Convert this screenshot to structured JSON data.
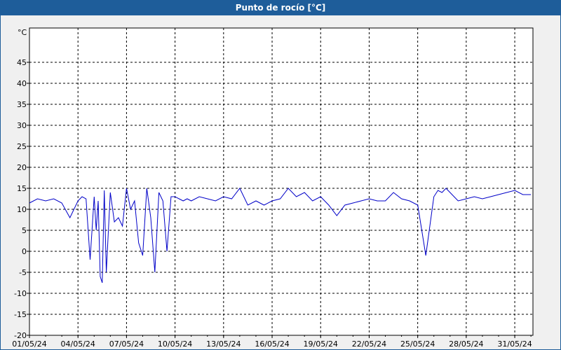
{
  "window": {
    "title": "Punto de rocío [°C]"
  },
  "colors": {
    "titlebar": "#1e5d9a",
    "series": "#0000c8",
    "plot_background": "#ffffff"
  },
  "chart_data": {
    "type": "line",
    "title": "Punto de rocío [°C]",
    "ylabel": "°C",
    "xlabel": "",
    "ylim": [
      -20,
      50
    ],
    "xlim": [
      "01/05/24",
      "01/06/24"
    ],
    "grid": true,
    "y_ticks": [
      "-20",
      "-15",
      "-10",
      "-5",
      "0",
      "5",
      "10",
      "15",
      "20",
      "25",
      "30",
      "35",
      "40",
      "45"
    ],
    "x_ticks": [
      "01/05/24",
      "04/05/24",
      "07/05/24",
      "10/05/24",
      "13/05/24",
      "16/05/24",
      "19/05/24",
      "22/05/24",
      "25/05/24",
      "28/05/24",
      "31/05/24"
    ],
    "series": [
      {
        "color": "#0000c8",
        "x": [
          "01/05 00:00",
          "01/05 12:00",
          "02/05 00:00",
          "02/05 12:00",
          "03/05 00:00",
          "03/05 12:00",
          "04/05 00:00",
          "04/05 06:00",
          "04/05 12:00",
          "04/05 18:00",
          "05/05 00:00",
          "05/05 03:00",
          "05/05 06:00",
          "05/05 09:00",
          "05/05 12:00",
          "05/05 15:00",
          "05/05 18:00",
          "06/05 00:00",
          "06/05 06:00",
          "06/05 12:00",
          "06/05 18:00",
          "07/05 00:00",
          "07/05 06:00",
          "07/05 12:00",
          "07/05 18:00",
          "08/05 00:00",
          "08/05 06:00",
          "08/05 12:00",
          "08/05 18:00",
          "09/05 00:00",
          "09/05 06:00",
          "09/05 12:00",
          "09/05 18:00",
          "10/05 00:00",
          "10/05 06:00",
          "10/05 12:00",
          "10/05 18:00",
          "11/05 00:00",
          "11/05 12:00",
          "12/05 00:00",
          "12/05 12:00",
          "13/05 00:00",
          "13/05 12:00",
          "14/05 00:00",
          "14/05 12:00",
          "15/05 00:00",
          "15/05 12:00",
          "16/05 00:00",
          "16/05 12:00",
          "17/05 00:00",
          "17/05 12:00",
          "18/05 00:00",
          "18/05 12:00",
          "19/05 00:00",
          "19/05 12:00",
          "20/05 00:00",
          "20/05 12:00",
          "21/05 00:00",
          "21/05 12:00",
          "22/05 00:00",
          "22/05 12:00",
          "23/05 00:00",
          "23/05 12:00",
          "24/05 00:00",
          "24/05 12:00",
          "25/05 00:00",
          "25/05 12:00",
          "26/05 00:00",
          "26/05 06:00",
          "26/05 12:00",
          "26/05 18:00",
          "27/05 00:00",
          "27/05 12:00",
          "28/05 00:00",
          "28/05 12:00",
          "29/05 00:00",
          "29/05 12:00",
          "30/05 00:00",
          "30/05 12:00",
          "31/05 00:00",
          "31/05 12:00",
          "01/06 00:00"
        ],
        "y": [
          11.5,
          12.5,
          12,
          12.5,
          11.5,
          8,
          12,
          13,
          12.5,
          -2,
          13,
          5,
          12,
          -6,
          -7.5,
          14.5,
          -5,
          14,
          7,
          8,
          6,
          15,
          10,
          12,
          2,
          -1,
          15,
          8,
          -5,
          14,
          12,
          0,
          13,
          13,
          12.5,
          12,
          12.5,
          12,
          13,
          12.5,
          12,
          13,
          12.5,
          15,
          11,
          12,
          11,
          12,
          12.5,
          15,
          13,
          14,
          12,
          13,
          11,
          8.5,
          11,
          11.5,
          12,
          12.5,
          12,
          12,
          14,
          12.5,
          12,
          11,
          -1,
          13,
          14.5,
          14,
          15,
          14,
          12,
          12.5,
          13,
          12.5,
          13,
          13.5,
          14,
          14.5,
          13.5,
          13.5
        ]
      }
    ]
  }
}
